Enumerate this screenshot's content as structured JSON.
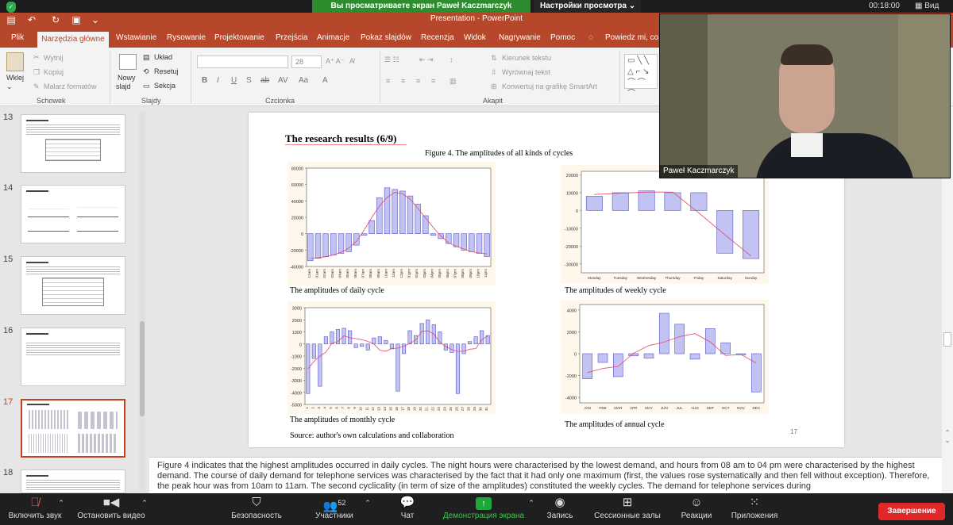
{
  "zoom": {
    "share_banner": "Вы просматриваете экран Paweł Kaczmarczyk",
    "view_options": "Настройки просмотра",
    "timer": "00:18:00",
    "view": "Вид"
  },
  "ppt": {
    "title": "Presentation - PowerPoint",
    "tabs": [
      "Plik",
      "Narzędzia główne",
      "Wstawianie",
      "Rysowanie",
      "Projektowanie",
      "Przejścia",
      "Animacje",
      "Pokaz slajdów",
      "Recenzja",
      "Widok",
      "Nagrywanie",
      "Pomoc"
    ],
    "tell_me": "Powiedz mi, co c",
    "ribbon": {
      "paste": "Wklej",
      "cut": "Wytnij",
      "copy": "Kopiuj",
      "format_painter": "Malarz formatów",
      "clipboard": "Schowek",
      "new_slide_1": "Nowy",
      "new_slide_2": "slajd",
      "layout": "Układ",
      "reset": "Resetuj",
      "section": "Sekcja",
      "slides": "Slajdy",
      "font_size": "28",
      "font_group": "Czcionka",
      "text_direction": "Kierunek tekstu",
      "align_text": "Wyrównaj tekst",
      "smartart": "Konwertuj na grafikę SmartArt",
      "paragraph": "Akapit"
    },
    "thumb_numbers": [
      "13",
      "14",
      "15",
      "16",
      "17",
      "18"
    ]
  },
  "slide": {
    "title": "The research results (6/9)",
    "figure_caption": "Figure 4. The amplitudes of all kinds of cycles",
    "daily_caption": "The amplitudes of daily cycle",
    "weekly_caption": "The amplitudes of weekly cycle",
    "monthly_caption": "The amplitudes of monthly cycle",
    "annual_caption": "The amplitudes of annual cycle",
    "source": "Source: author's own calculations and collaboration",
    "page_number": "17"
  },
  "notes": "Figure 4 indicates that the highest amplitudes occurred in daily cycles. The night hours were characterised by the lowest demand, and hours from 08 am to 04 pm were characterised by the highest demand. The course of daily demand for telephone services was characterised by the fact that it had only one maximum (first, the values rose systematically and then fell without exception). Therefore, the peak hour was from 10am to 11am. The second cyclicality (in term of size of the amplitudes) constituted the weekly cycles. The demand for telephone services during",
  "toolbar": {
    "mute": "Включить звук",
    "video": "Остановить видео",
    "security": "Безопасность",
    "participants": "Участники",
    "participants_count": "52",
    "chat": "Чат",
    "share": "Демонстрация экрана",
    "record": "Запись",
    "breakout": "Сессионные залы",
    "reactions": "Реакции",
    "apps": "Приложения",
    "end": "Завершение"
  },
  "webcam": {
    "name": "Paweł Kaczmarczyk"
  },
  "chart_data": [
    {
      "type": "bar",
      "name": "daily",
      "categories": [
        "12am",
        "01am",
        "02am",
        "03am",
        "04am",
        "05am",
        "06am",
        "07am",
        "08am",
        "09am",
        "10am",
        "11am",
        "12pm",
        "01pm",
        "02pm",
        "03pm",
        "04pm",
        "05pm",
        "06pm",
        "07pm",
        "08pm",
        "09pm",
        "10pm",
        "11pm"
      ],
      "values": [
        -33000,
        -30000,
        -28000,
        -26000,
        -24000,
        -22000,
        -14000,
        -2000,
        16000,
        44000,
        56000,
        54000,
        52000,
        46000,
        36000,
        22000,
        -2000,
        -6000,
        -12000,
        -16000,
        -20000,
        -22000,
        -24000,
        -28000
      ],
      "yticks": [
        80000,
        60000,
        40000,
        20000,
        0,
        -20000,
        -40000
      ],
      "ylim": [
        -40000,
        80000
      ]
    },
    {
      "type": "bar",
      "name": "weekly",
      "categories": [
        "Monday",
        "Tuesday",
        "Wednesday",
        "Thursday",
        "Friday",
        "Saturday",
        "Sunday"
      ],
      "values": [
        8000,
        10000,
        11000,
        10000,
        10000,
        -24000,
        -27000
      ],
      "yticks": [
        20000,
        10000,
        0,
        -10000,
        -20000,
        -30000
      ],
      "ylim": [
        -35000,
        22000
      ]
    },
    {
      "type": "bar",
      "name": "monthly",
      "categories": [
        "1",
        "2",
        "3",
        "4",
        "5",
        "6",
        "7",
        "8",
        "9",
        "10",
        "11",
        "12",
        "13",
        "14",
        "15",
        "16",
        "17",
        "18",
        "19",
        "20",
        "21",
        "22",
        "23",
        "24",
        "25",
        "26",
        "27",
        "28",
        "29",
        "30",
        "31"
      ],
      "values": [
        -4100,
        -1200,
        -3500,
        600,
        1000,
        1200,
        1300,
        1100,
        -300,
        -200,
        -500,
        500,
        600,
        300,
        -400,
        -3900,
        -800,
        1100,
        700,
        1700,
        2000,
        1600,
        1000,
        -500,
        -700,
        -4100,
        -800,
        200,
        600,
        1100,
        700
      ],
      "yticks": [
        3000,
        2000,
        1000,
        0,
        -1000,
        -2000,
        -3000,
        -4000,
        -5000
      ],
      "ylim": [
        -5000,
        3000
      ]
    },
    {
      "type": "bar",
      "name": "annual",
      "categories": [
        "JAN",
        "FEB",
        "MAR",
        "APR",
        "MAY",
        "JUN",
        "JUL",
        "AUG",
        "SEP",
        "OCT",
        "NOV",
        "DEC"
      ],
      "values": [
        -2300,
        -800,
        -2100,
        -200,
        -400,
        3700,
        2700,
        -500,
        2300,
        1000,
        -100,
        -3500
      ],
      "yticks": [
        4000,
        2000,
        0,
        -2000,
        -4000
      ],
      "ylim": [
        -4500,
        4500
      ]
    }
  ]
}
